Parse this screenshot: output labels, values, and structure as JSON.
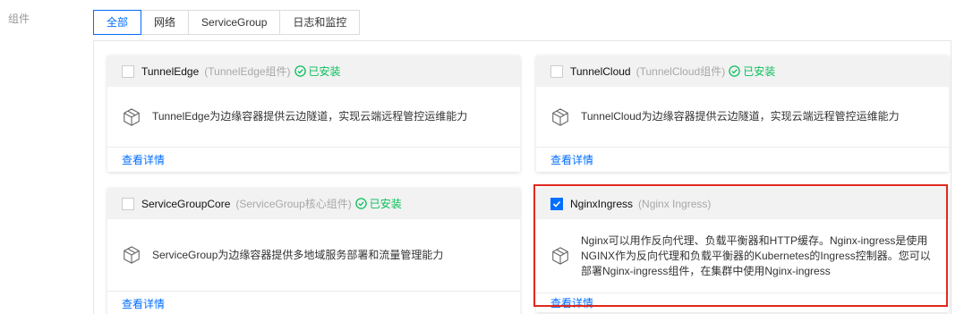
{
  "side_label": "组件",
  "tabs": [
    {
      "label": "全部",
      "active": true
    },
    {
      "label": "网络",
      "active": false
    },
    {
      "label": "ServiceGroup",
      "active": false
    },
    {
      "label": "日志和监控",
      "active": false
    }
  ],
  "cards": [
    {
      "name": "TunnelEdge",
      "subtitle": "(TunnelEdge组件)",
      "installed": "已安装",
      "description": "TunnelEdge为边缘容器提供云边隧道，实现云端远程管控运维能力",
      "link": "查看详情",
      "checked": false
    },
    {
      "name": "TunnelCloud",
      "subtitle": "(TunnelCloud组件)",
      "installed": "已安装",
      "description": "TunnelCloud为边缘容器提供云边隧道，实现云端远程管控运维能力",
      "link": "查看详情",
      "checked": false
    },
    {
      "name": "ServiceGroupCore",
      "subtitle": "(ServiceGroup核心组件)",
      "installed": "已安装",
      "description": "ServiceGroup为边缘容器提供多地域服务部署和流量管理能力",
      "link": "查看详情",
      "checked": false
    },
    {
      "name": "NginxIngress",
      "subtitle": "(Nginx Ingress)",
      "installed": "",
      "description": "Nginx可以用作反向代理、负载平衡器和HTTP缓存。Nginx-ingress是使用NGINX作为反向代理和负载平衡器的Kubernetes的Ingress控制器。您可以部署Nginx-ingress组件，在集群中使用Nginx-ingress",
      "link": "查看详情",
      "checked": true
    }
  ],
  "colors": {
    "accent": "#006eff",
    "installed": "#0abf5b",
    "highlight": "#e0281e"
  }
}
